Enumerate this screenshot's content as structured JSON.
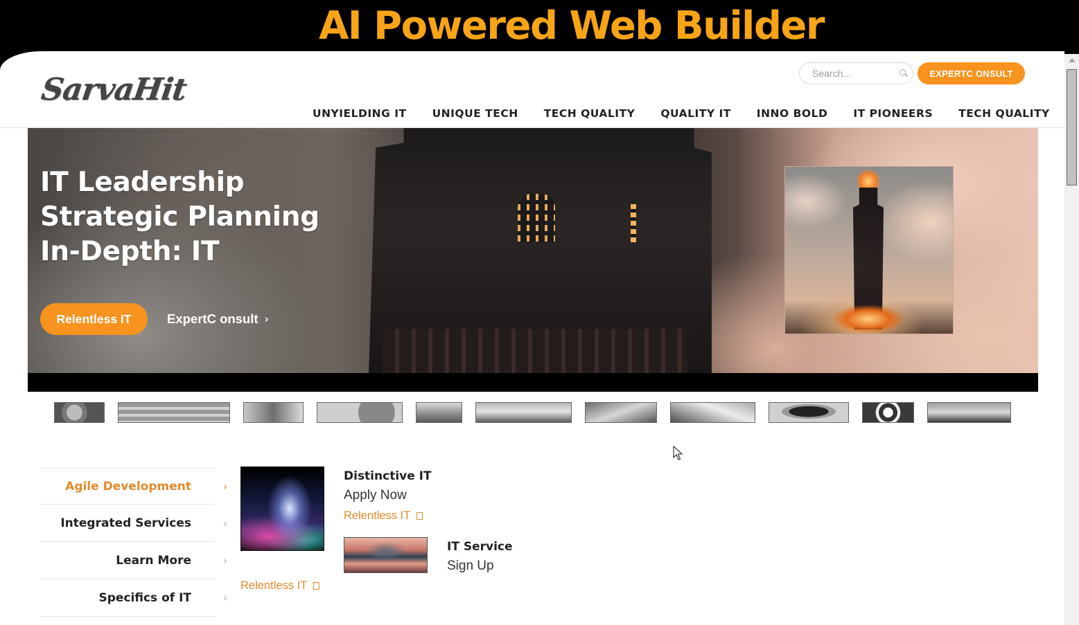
{
  "banner": {
    "title": "AI Powered Web Builder"
  },
  "header": {
    "logo_text": "SarvaHit",
    "search_placeholder": "Search...",
    "consult_button": "EXPERTC ONSULT",
    "nav": [
      "UNYIELDING IT",
      "UNIQUE TECH",
      "TECH QUALITY",
      "QUALITY IT",
      "INNO BOLD",
      "IT PIONEERS",
      "TECH QUALITY"
    ]
  },
  "hero": {
    "lines": [
      "IT Leadership",
      "Strategic Planning",
      "In-Depth: IT"
    ],
    "primary_button": "Relentless IT",
    "secondary_link": "ExpertC onsult",
    "secondary_chevron": "›"
  },
  "side_menu": [
    {
      "label": "Agile Development",
      "active": true
    },
    {
      "label": "Integrated Services",
      "active": false
    },
    {
      "label": "Learn More",
      "active": false
    },
    {
      "label": "Specifics of IT",
      "active": false
    }
  ],
  "cards": {
    "card1": {
      "title": "Distinctive IT",
      "subtitle": "Apply Now",
      "link": "Relentless IT"
    },
    "card2": {
      "title": "IT Service",
      "subtitle": "Sign Up"
    },
    "bottom_link": "Relentless IT"
  },
  "colors": {
    "accent": "#f7931e",
    "banner_title": "#f7a416",
    "link": "#e48a2c"
  }
}
